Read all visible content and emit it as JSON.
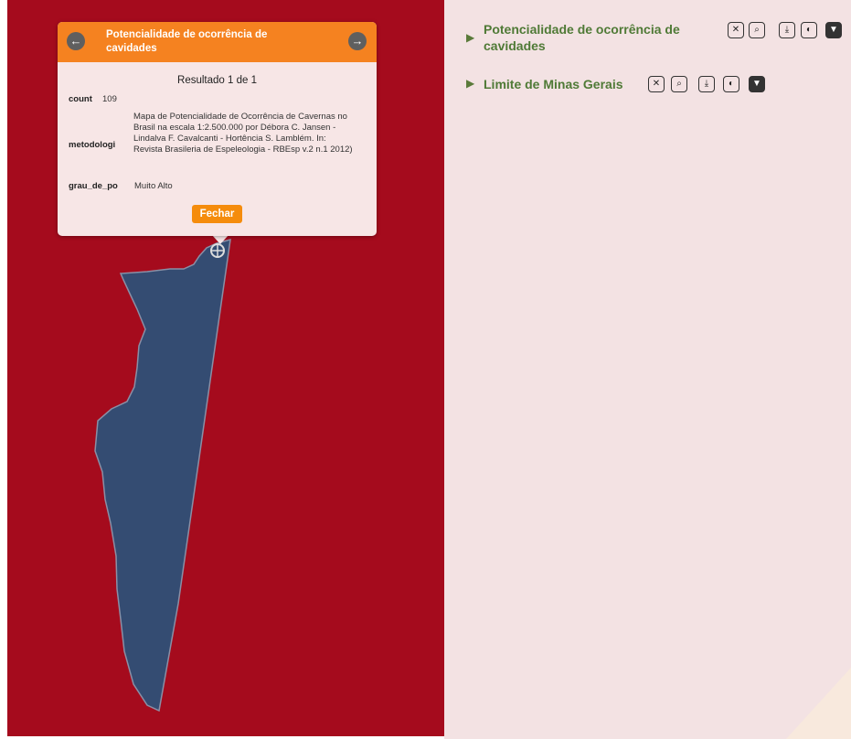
{
  "popup": {
    "title": "Potencialidade de ocorrência de cavidades",
    "result": "Resultado 1 de 1",
    "prev_icon": "←",
    "next_icon": "→",
    "fields": [
      {
        "key": "count",
        "value": "109"
      },
      {
        "key": "metodologi",
        "value": "Mapa de Potencialidade de Ocorrência de Cavernas no Brasil na escala 1:2.500.000 por Débora C. Jansen - Lindalva F. Cavalcanti - Hortência S. Lamblém. In: Revista Brasileria de Espeleologia - RBEsp v.2 n.1 2012)"
      },
      {
        "key": "grau_de_po",
        "value": "Muito Alto"
      }
    ],
    "close_label": "Fechar"
  },
  "layers": [
    {
      "name": "Potencialidade de ocorrência de cavidades",
      "expand_icon": "▶"
    },
    {
      "name": "Limite de Minas Gerais",
      "expand_icon": "▶"
    }
  ],
  "tools": [
    {
      "icon": "close-icon",
      "glyph": "✕"
    },
    {
      "icon": "zoom-icon",
      "glyph": "⌕"
    },
    {
      "icon": "download-icon",
      "glyph": "⤓"
    },
    {
      "icon": "label-icon",
      "glyph": "◐"
    },
    {
      "icon": "filter-icon",
      "glyph": "▼"
    }
  ],
  "colors": {
    "map_background": "#a50b1d",
    "polygon_fill": "#344c72",
    "panel_background": "#f3e2e3",
    "popup_header": "#f58220",
    "layer_text": "#4f7a36"
  }
}
